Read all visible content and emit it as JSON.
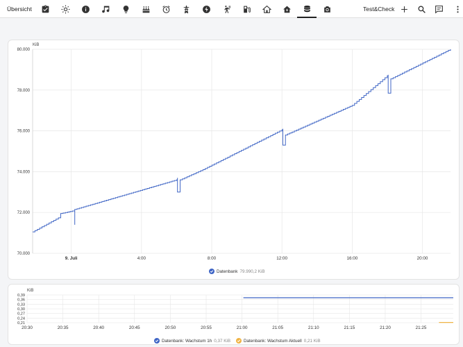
{
  "topbar": {
    "title": "Übersicht",
    "right_title": "Test&Check",
    "tabs": [
      {
        "name": "clipboard-check-icon"
      },
      {
        "name": "sun-icon"
      },
      {
        "name": "info-icon"
      },
      {
        "name": "music-note-icon"
      },
      {
        "name": "lightbulb-icon"
      },
      {
        "name": "cake-icon"
      },
      {
        "name": "alarm-clock-icon"
      },
      {
        "name": "transmission-tower-icon"
      },
      {
        "name": "lightning-bolt-icon"
      },
      {
        "name": "walking-sensor-icon"
      },
      {
        "name": "fuel-pump-icon"
      },
      {
        "name": "home-icon"
      },
      {
        "name": "home-lightning-icon"
      },
      {
        "name": "database-icon"
      },
      {
        "name": "camera-icon"
      }
    ],
    "actions": [
      {
        "name": "plus-icon"
      },
      {
        "name": "search-icon"
      },
      {
        "name": "message-icon"
      },
      {
        "name": "more-vertical-icon"
      }
    ]
  },
  "colors": {
    "series_blue": "#3f65c5",
    "series_orange": "#f0b445",
    "grid": "#e6e6e6"
  },
  "chart_data": [
    {
      "type": "line",
      "ylabel": "KiB",
      "ylim": [
        70000,
        80000
      ],
      "y_ticks": [
        "70.000",
        "72.000",
        "74.000",
        "76.000",
        "78.000",
        "80.000"
      ],
      "x_ticks": [
        "9. Juli",
        "4:00",
        "8:00",
        "12:00",
        "16:00",
        "20:00"
      ],
      "x_tick_hours": [
        0,
        4,
        8,
        12,
        16,
        20
      ],
      "xlim_hours": [
        -2.2,
        21.6
      ],
      "series": [
        {
          "name": "Datenbank",
          "legend_value": "79.990,2 KiB",
          "x_hours": [
            -2.2,
            -0.6,
            -0.6,
            0.2,
            0.2,
            0.2,
            6.0,
            6.05,
            6.05,
            6.2,
            6.2,
            7.5,
            12.0,
            12.05,
            12.05,
            12.2,
            12.2,
            16.0,
            18.0,
            18.05,
            18.05,
            18.2,
            18.2,
            21.6
          ],
          "values": [
            71050,
            71800,
            71950,
            72100,
            71400,
            72150,
            73600,
            73700,
            73000,
            73550,
            73600,
            74100,
            76050,
            76100,
            75300,
            75700,
            75800,
            77250,
            78700,
            78750,
            77850,
            78450,
            78550,
            80000
          ]
        }
      ]
    },
    {
      "type": "line",
      "ylabel": "KiB",
      "ylim": [
        0.21,
        0.39
      ],
      "y_ticks": [
        "0,21",
        "0,24",
        "0,27",
        "0,30",
        "0,33",
        "0,36",
        "0,39"
      ],
      "x_ticks": [
        "20:30",
        "20:35",
        "20:40",
        "20:45",
        "20:50",
        "20:55",
        "21:00",
        "21:05",
        "21:10",
        "21:15",
        "21:20",
        "21:25"
      ],
      "xlim_minutes": [
        0,
        59.5
      ],
      "series": [
        {
          "name": "Datenbank: Wachstum 1h",
          "legend_value": "0,37 KiB",
          "x_minutes": [
            30.2,
            59.5
          ],
          "values": [
            0.372,
            0.372
          ]
        },
        {
          "name": "Datenbank: Wachstum Aktuell",
          "legend_value": "0,21 KiB",
          "x_minutes": [
            57.5,
            59.5
          ],
          "values": [
            0.212,
            0.212
          ]
        }
      ]
    }
  ]
}
